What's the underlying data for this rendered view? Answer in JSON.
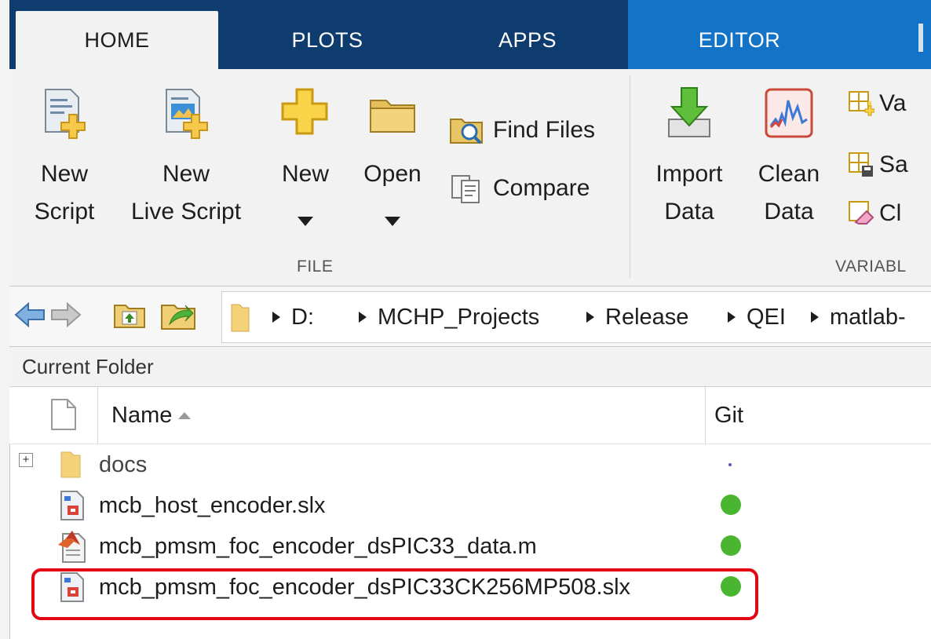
{
  "tabs": [
    {
      "label": "HOME",
      "active": true
    },
    {
      "label": "PLOTS",
      "active": false
    },
    {
      "label": "APPS",
      "active": false
    },
    {
      "label": "EDITOR",
      "active": false
    }
  ],
  "ribbon": {
    "file_group": {
      "label": "FILE",
      "new_script": {
        "line1": "New",
        "line2": "Script",
        "icon": "new-script-icon"
      },
      "new_live_script": {
        "line1": "New",
        "line2": "Live Script",
        "icon": "new-live-script-icon"
      },
      "new": {
        "label": "New",
        "icon": "plus-icon"
      },
      "open": {
        "label": "Open",
        "icon": "folder-icon"
      },
      "find_files": {
        "label": "Find Files",
        "icon": "find-files-icon"
      },
      "compare": {
        "label": "Compare",
        "icon": "compare-icon"
      }
    },
    "variable_group": {
      "label": "VARIABL",
      "import_data": {
        "line1": "Import",
        "line2": "Data",
        "icon": "import-data-icon"
      },
      "clean_data": {
        "line1": "Clean",
        "line2": "Data",
        "icon": "clean-data-icon"
      },
      "new_variable": {
        "label": "Va",
        "icon": "new-variable-icon"
      },
      "save_workspace": {
        "label": "Sa",
        "icon": "save-workspace-icon"
      },
      "clear_workspace": {
        "label": "Cl",
        "icon": "clear-workspace-icon"
      }
    }
  },
  "address_bar": {
    "breadcrumbs": [
      "D:",
      "MCHP_Projects",
      "Release",
      "QEI",
      "matlab-"
    ]
  },
  "current_folder": {
    "title": "Current Folder",
    "columns": {
      "name": "Name",
      "git": "Git"
    },
    "rows": [
      {
        "name": "docs",
        "type": "folder",
        "git": "untracked"
      },
      {
        "name": "mcb_host_encoder.slx",
        "type": "slx",
        "git": "unmodified"
      },
      {
        "name": "mcb_pmsm_foc_encoder_dsPIC33_data.m",
        "type": "m",
        "git": "unmodified"
      },
      {
        "name": "mcb_pmsm_foc_encoder_dsPIC33CK256MP508.slx",
        "type": "slx",
        "git": "unmodified",
        "highlighted": true
      }
    ]
  },
  "colors": {
    "tab_dark": "#0f3c6e",
    "tab_editor": "#1273c7",
    "git_clean": "#4ab531",
    "highlight": "#e30613"
  }
}
